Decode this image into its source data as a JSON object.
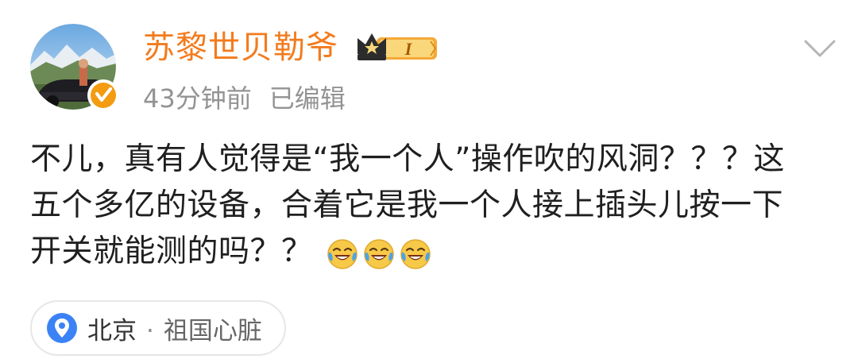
{
  "post": {
    "author": {
      "name": "苏黎世贝勒爷",
      "level_label": "I",
      "verified": true
    },
    "meta": {
      "time": "43分钟前",
      "edited": "已编辑"
    },
    "content": {
      "line1": "不儿，真有人觉得是“我一个人”操作吹的风洞？？？这",
      "line2": "五个多亿的设备，合着它是我一个人接上插头儿按一下",
      "line3": "开关就能测的吗？？",
      "emojis": [
        "laugh-cry-emoji",
        "laugh-cry-emoji",
        "laugh-cry-emoji"
      ]
    },
    "location": {
      "city": "北京",
      "separator": "·",
      "description": "祖国心脏"
    }
  },
  "colors": {
    "username": "#f37b1d",
    "meta": "#939393",
    "verified_badge": "#f39c12",
    "location_pin": "#3b82f6"
  },
  "icons": {
    "more_menu": "chevron-down-icon",
    "verified": "verified-badge-icon",
    "level": "crown-level-badge-icon",
    "location": "map-pin-icon"
  }
}
